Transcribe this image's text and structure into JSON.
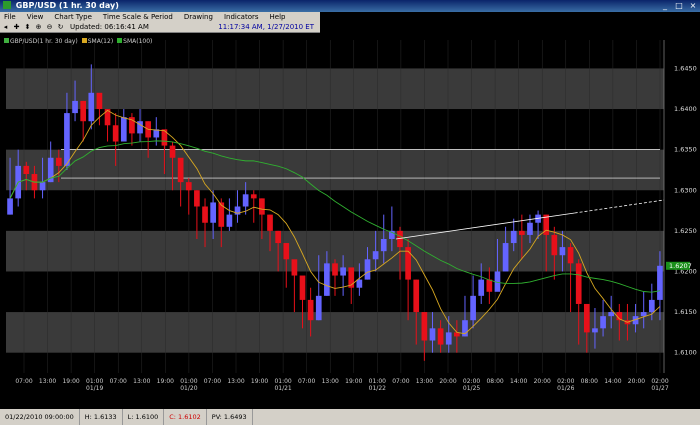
{
  "window": {
    "title": "GBP/USD (1 hr. 30 day)"
  },
  "menu": [
    "File",
    "View",
    "Chart Type",
    "Time Scale & Period",
    "Drawing",
    "Indicators",
    "Help"
  ],
  "toolbar": {
    "updated": "Updated: 06:16:41 AM",
    "clock": "11:17:34 AM, 1/27/2010 ET"
  },
  "legend": {
    "symbol": "GBP/USD(1 hr. 30 day)",
    "sma12": "SMA(12)",
    "sma100": "SMA(100)"
  },
  "status": {
    "date": "01/22/2010 09:00:00",
    "high": "H: 1.6133",
    "low": "L: 1.6100",
    "close": "C: 1.6102",
    "pv": "PV: 1.6493"
  },
  "colors": {
    "up": "#6464ff",
    "down": "#e8101a",
    "sma12": "#d8a820",
    "sma100": "#30b030",
    "band": "#3a3a3a"
  },
  "chart_data": {
    "type": "candlestick",
    "ylim": [
      1.6075,
      1.6485
    ],
    "y_ticks": [
      "1.6450",
      "1.6400",
      "1.6350",
      "1.6300",
      "1.6250",
      "1.6200",
      "1.6150",
      "1.6100"
    ],
    "current_price": "1.6207",
    "x_ticks": [
      {
        "time": "07:00",
        "date": ""
      },
      {
        "time": "13:00",
        "date": ""
      },
      {
        "time": "19:00",
        "date": ""
      },
      {
        "time": "01:00",
        "date": "01/19"
      },
      {
        "time": "07:00",
        "date": ""
      },
      {
        "time": "13:00",
        "date": ""
      },
      {
        "time": "19:00",
        "date": ""
      },
      {
        "time": "01:00",
        "date": "01/20"
      },
      {
        "time": "07:00",
        "date": ""
      },
      {
        "time": "13:00",
        "date": ""
      },
      {
        "time": "19:00",
        "date": ""
      },
      {
        "time": "01:00",
        "date": "01/21"
      },
      {
        "time": "07:00",
        "date": ""
      },
      {
        "time": "13:00",
        "date": ""
      },
      {
        "time": "19:00",
        "date": ""
      },
      {
        "time": "01:00",
        "date": "01/22"
      },
      {
        "time": "07:00",
        "date": ""
      },
      {
        "time": "13:00",
        "date": ""
      },
      {
        "time": "20:00",
        "date": ""
      },
      {
        "time": "02:00",
        "date": "01/25"
      },
      {
        "time": "08:00",
        "date": ""
      },
      {
        "time": "14:00",
        "date": ""
      },
      {
        "time": "20:00",
        "date": ""
      },
      {
        "time": "02:00",
        "date": "01/26"
      },
      {
        "time": "08:00",
        "date": ""
      },
      {
        "time": "14:00",
        "date": ""
      },
      {
        "time": "20:00",
        "date": ""
      },
      {
        "time": "02:00",
        "date": "01/27"
      }
    ],
    "close": [
      1.629,
      1.633,
      1.632,
      1.63,
      1.631,
      1.634,
      1.633,
      1.6395,
      1.641,
      1.6385,
      1.642,
      1.64,
      1.638,
      1.636,
      1.639,
      1.637,
      1.6385,
      1.6365,
      1.6375,
      1.6355,
      1.634,
      1.631,
      1.63,
      1.628,
      1.626,
      1.6285,
      1.6255,
      1.627,
      1.628,
      1.6295,
      1.629,
      1.627,
      1.625,
      1.6235,
      1.6215,
      1.6195,
      1.6165,
      1.614,
      1.617,
      1.621,
      1.6195,
      1.6205,
      1.618,
      1.619,
      1.6215,
      1.6225,
      1.624,
      1.625,
      1.623,
      1.619,
      1.615,
      1.6115,
      1.613,
      1.611,
      1.6125,
      1.612,
      1.614,
      1.617,
      1.619,
      1.6175,
      1.62,
      1.6235,
      1.625,
      1.6245,
      1.626,
      1.627,
      1.6245,
      1.622,
      1.623,
      1.621,
      1.616,
      1.6125,
      1.613,
      1.6145,
      1.615,
      1.614,
      1.6135,
      1.6145,
      1.615,
      1.6165,
      1.6207
    ],
    "high": [
      1.634,
      1.635,
      1.6335,
      1.633,
      1.634,
      1.636,
      1.635,
      1.642,
      1.6435,
      1.641,
      1.6455,
      1.6415,
      1.64,
      1.6395,
      1.64,
      1.6395,
      1.64,
      1.6385,
      1.639,
      1.637,
      1.636,
      1.633,
      1.6315,
      1.63,
      1.629,
      1.63,
      1.629,
      1.629,
      1.63,
      1.631,
      1.63,
      1.629,
      1.627,
      1.625,
      1.6235,
      1.621,
      1.619,
      1.618,
      1.622,
      1.6225,
      1.6215,
      1.622,
      1.62,
      1.621,
      1.623,
      1.625,
      1.627,
      1.628,
      1.6255,
      1.624,
      1.619,
      1.6145,
      1.615,
      1.614,
      1.6145,
      1.614,
      1.617,
      1.6195,
      1.621,
      1.6205,
      1.624,
      1.6255,
      1.6265,
      1.627,
      1.627,
      1.6275,
      1.627,
      1.6255,
      1.625,
      1.6235,
      1.6215,
      1.616,
      1.6155,
      1.6165,
      1.617,
      1.616,
      1.616,
      1.616,
      1.6175,
      1.6185,
      1.6225
    ],
    "low": [
      1.627,
      1.628,
      1.63,
      1.629,
      1.629,
      1.631,
      1.631,
      1.6325,
      1.6385,
      1.636,
      1.6375,
      1.638,
      1.636,
      1.633,
      1.636,
      1.6355,
      1.636,
      1.634,
      1.6355,
      1.632,
      1.63,
      1.628,
      1.627,
      1.624,
      1.623,
      1.624,
      1.623,
      1.625,
      1.626,
      1.627,
      1.626,
      1.624,
      1.6225,
      1.62,
      1.618,
      1.615,
      1.613,
      1.612,
      1.614,
      1.617,
      1.617,
      1.617,
      1.616,
      1.617,
      1.619,
      1.62,
      1.621,
      1.6225,
      1.619,
      1.614,
      1.611,
      1.609,
      1.61,
      1.61,
      1.61,
      1.61,
      1.612,
      1.613,
      1.616,
      1.616,
      1.618,
      1.62,
      1.6225,
      1.6215,
      1.6235,
      1.624,
      1.62,
      1.619,
      1.62,
      1.615,
      1.611,
      1.61,
      1.6105,
      1.612,
      1.613,
      1.6115,
      1.6115,
      1.6125,
      1.613,
      1.614,
      1.614
    ]
  }
}
